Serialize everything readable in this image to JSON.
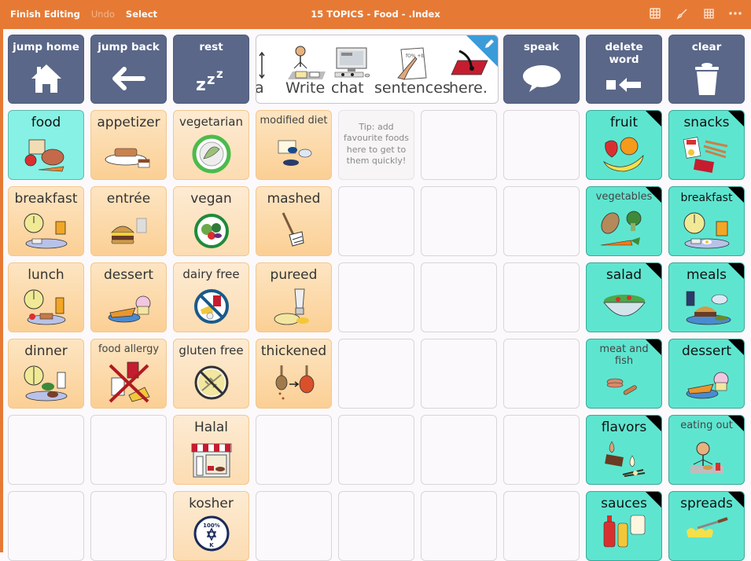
{
  "topbar": {
    "finish_editing": "Finish Editing",
    "undo": "Undo",
    "select": "Select",
    "title": "15 TOPICS - Food - .Index",
    "icons": [
      "grid-edit-icon",
      "paintbrush-icon",
      "grid-icon",
      "more-icon"
    ]
  },
  "colors": {
    "topbar": "#e67a35",
    "nav_button": "#5a6788",
    "orange_cell": "#fbcf94",
    "teal_cell": "#5ee5d0",
    "edit_corner": "#3b9bd9"
  },
  "nav": {
    "jump_home": "jump home",
    "jump_back": "jump back",
    "rest": "rest",
    "speak": "speak",
    "delete_word": "delete word",
    "clear": "clear"
  },
  "sentence_bar": {
    "partial_word": "a",
    "words": [
      "Write",
      "chat",
      "sentences",
      "here."
    ]
  },
  "grid": {
    "col1": [
      "food",
      "breakfast",
      "lunch",
      "dinner"
    ],
    "col2": [
      "appetizer",
      "entrée",
      "dessert",
      "food allergy"
    ],
    "col3": [
      "vegetarian",
      "vegan",
      "dairy free",
      "gluten free",
      "Halal",
      "kosher"
    ],
    "col4": [
      "modified diet",
      "mashed",
      "pureed",
      "thickened"
    ],
    "tip": "Tip: add favourite foods here to get to them quickly!",
    "col8": [
      "fruit",
      "vegetables",
      "salad",
      "meat and fish",
      "flavors",
      "sauces"
    ],
    "col9": [
      "snacks",
      "breakfast",
      "meals",
      "dessert",
      "eating out",
      "spreads"
    ]
  }
}
